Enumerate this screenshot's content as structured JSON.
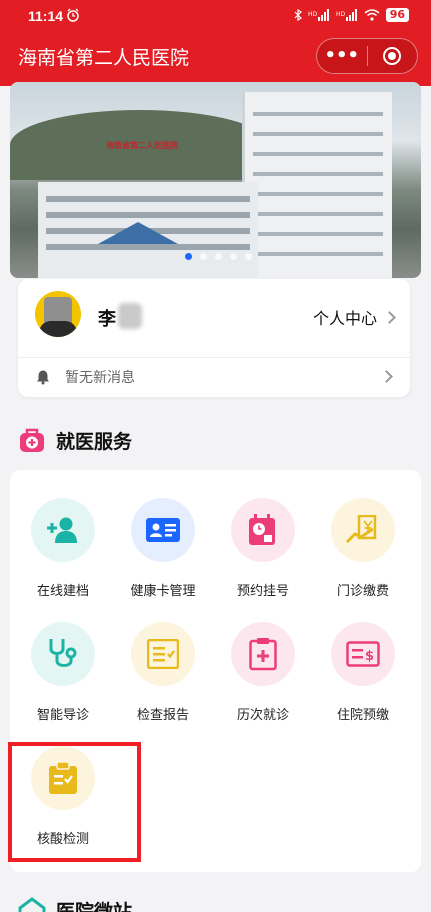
{
  "status_bar": {
    "time": "11:14",
    "signal1": "HD 4G",
    "signal2": "HD 4G",
    "battery": "96"
  },
  "nav": {
    "title": "海南省第二人民医院",
    "more_label": "•••"
  },
  "banner": {
    "sign_text": "海南省第二人民医院",
    "slide_count": 5,
    "active_slide": 1
  },
  "user": {
    "name": "李",
    "center_label": "个人中心"
  },
  "notice": {
    "text": "暂无新消息"
  },
  "section": {
    "title": "就医服务",
    "next_title": "医院微站"
  },
  "services": [
    {
      "label": "在线建档",
      "icon": "add-user-icon",
      "color": "#1bb3a6",
      "bg": "#e4f6f3"
    },
    {
      "label": "健康卡管理",
      "icon": "id-card-icon",
      "color": "#1a66ff",
      "bg": "#e5eeff"
    },
    {
      "label": "预约挂号",
      "icon": "appointment-icon",
      "color": "#ec3d7a",
      "bg": "#fde7ef"
    },
    {
      "label": "门诊缴费",
      "icon": "payment-icon",
      "color": "#e8b91b",
      "bg": "#fdf4dd"
    },
    {
      "label": "智能导诊",
      "icon": "stethoscope-icon",
      "color": "#1bb3a6",
      "bg": "#e4f6f3"
    },
    {
      "label": "检查报告",
      "icon": "report-icon",
      "color": "#e8b91b",
      "bg": "#fdf4dd"
    },
    {
      "label": "历次就诊",
      "icon": "medical-record-icon",
      "color": "#ec3d7a",
      "bg": "#fde7ef"
    },
    {
      "label": "住院预缴",
      "icon": "prepay-icon",
      "color": "#ec3d7a",
      "bg": "#fde7ef"
    },
    {
      "label": "核酸检测",
      "icon": "nucleic-test-icon",
      "color": "#e8b91b",
      "bg": "#fdf4dd"
    }
  ],
  "colors": {
    "brand_red": "#e21d23",
    "highlight_red": "#ee1f26"
  }
}
